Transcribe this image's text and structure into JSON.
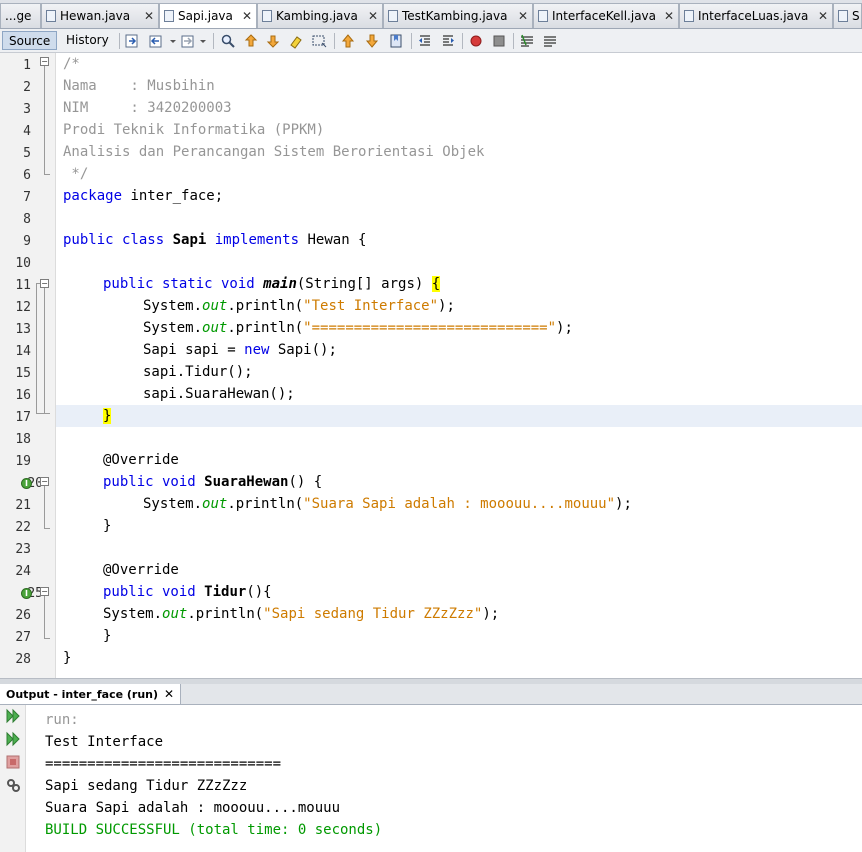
{
  "tabs": [
    {
      "label": "...ge",
      "active": false
    },
    {
      "label": "Hewan.java",
      "active": false
    },
    {
      "label": "Sapi.java",
      "active": true
    },
    {
      "label": "Kambing.java",
      "active": false
    },
    {
      "label": "TestKambing.java",
      "active": false
    },
    {
      "label": "InterfaceKell.java",
      "active": false
    },
    {
      "label": "InterfaceLuas.java",
      "active": false
    },
    {
      "label": "S",
      "active": false
    }
  ],
  "tab_close_glyph": "✕",
  "toolbar": {
    "source_label": "Source",
    "history_label": "History"
  },
  "editor": {
    "line_numbers": [
      "1",
      "2",
      "3",
      "4",
      "5",
      "6",
      "7",
      "8",
      "9",
      "10",
      "11",
      "12",
      "13",
      "14",
      "15",
      "16",
      "17",
      "18",
      "19",
      "20",
      "21",
      "22",
      "23",
      "24",
      "25",
      "26",
      "27",
      "28"
    ],
    "lines": {
      "l1": "/*",
      "l2": "Nama    : Musbihin",
      "l3": "NIM     : 3420200003",
      "l4": "Prodi Teknik Informatika (PPKM)",
      "l5": "Analisis dan Perancangan Sistem Berorientasi Objek",
      "l6": " */",
      "l7_kw": "package",
      "l7_rest": " inter_face;",
      "l9_kw1": "public class",
      "l9_name": "Sapi",
      "l9_kw2": "implements",
      "l9_rest": " Hewan {",
      "l11_kw": "public static void",
      "l11_name": "main",
      "l11_rest": "(String[] args) ",
      "l11_brace": "{",
      "l12_a": "System.",
      "l12_out": "out",
      "l12_b": ".println(",
      "l12_str": "\"Test Interface\"",
      "l12_c": ");",
      "l13_a": "System.",
      "l13_out": "out",
      "l13_b": ".println(",
      "l13_str": "\"============================\"",
      "l13_c": ");",
      "l14_a": "Sapi sapi = ",
      "l14_kw": "new",
      "l14_b": " Sapi();",
      "l15": "sapi.Tidur();",
      "l16": "sapi.SuaraHewan();",
      "l17_brace": "}",
      "l19": "@Override",
      "l20_kw": "public void",
      "l20_name": "SuaraHewan",
      "l20_rest": "() {",
      "l21_a": "System.",
      "l21_out": "out",
      "l21_b": ".println(",
      "l21_str": "\"Suara Sapi adalah : mooouu....mouuu\"",
      "l21_c": ");",
      "l22": "}",
      "l24": "@Override",
      "l25_kw": "public void",
      "l25_name": "Tidur",
      "l25_rest": "(){",
      "l26_a": "System.",
      "l26_out": "out",
      "l26_b": ".println(",
      "l26_str": "\"Sapi sedang Tidur ZZzZzz\"",
      "l26_c": ");",
      "l27": "}",
      "l28": "}"
    }
  },
  "output": {
    "tab_label": "Output - inter_face (run)",
    "lines": {
      "run": "run:",
      "o1": "Test Interface",
      "o2": "============================",
      "o3": "Sapi sedang Tidur ZZzZzz",
      "o4": "Suara Sapi adalah : mooouu....mouuu",
      "build": "BUILD SUCCESSFUL (total time: 0 seconds)"
    }
  },
  "colors": {
    "keyword": "#0000e6",
    "string": "#ce7b00",
    "comment": "#969696",
    "field": "#009900",
    "build_success": "#009900"
  }
}
